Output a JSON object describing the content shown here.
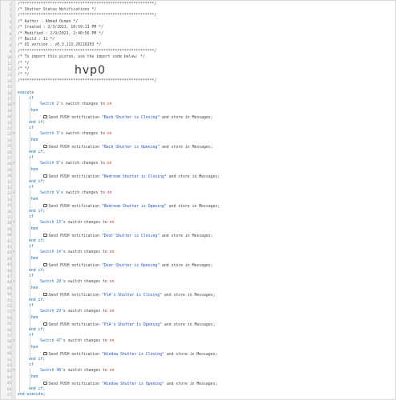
{
  "header": [
    "/**********************************************************/",
    "/* Shutter Status Notifications                            */",
    "/**********************************************************/",
    "/* Author       : Ahmed Osman                              */",
    "/* Created      : 2/3/2021, 10:59:13 PM                    */",
    "/* Modified     : 2/9/2021, 2:40:56 PM                     */",
    "/* Build        : 11                                       */",
    "/* UI version   : v0.3.113.20210203                        */",
    "/**********************************************************/",
    "/* To import this piston, use the import code below:      */",
    "/*                                                         */",
    "/*                                                         */",
    "/*                                                         */",
    "/**********************************************************/"
  ],
  "import_code": "hvp0",
  "kw": {
    "execute": "execute",
    "end_execute": "end execute;",
    "if": "if",
    "then": "then",
    "end_if": "end if;",
    "trigger": "⚡"
  },
  "blocks": [
    {
      "device": "Switch 2",
      "message": "\"Back Shutter is Closing\""
    },
    {
      "device": "Switch 3",
      "message": "\"Back Shutter is Opening\""
    },
    {
      "device": "Switch 8",
      "message": "\"Bedroom Shutter is Closing\""
    },
    {
      "device": "Switch 9",
      "message": "\"Bedroom Shutter is Opening\""
    },
    {
      "device": "Switch 13",
      "message": "\"Door Shutter is Closing\""
    },
    {
      "device": "Switch 14",
      "message": "\"Door Shutter is Opening\""
    },
    {
      "device": "Switch 28",
      "message": "\"PiA's Shutter is Closing\""
    },
    {
      "device": "Switch 29",
      "message": "\"PiA's Shutter is Opening\""
    },
    {
      "device": "Switch 47",
      "message": "\"Window Shutter is Closing\""
    },
    {
      "device": "Switch 48",
      "message": "\"Window Shutter is Opening\""
    }
  ],
  "phrases": {
    "possessive": "'s switch changes to",
    "value": "on",
    "send_prefix": "Send PUSH notification",
    "send_suffix": "and store in Messages;"
  },
  "line_numbers": [
    "1",
    "2",
    "3",
    "4",
    "5",
    "6",
    "7",
    "8",
    "9",
    "10",
    "11",
    "12",
    "13",
    "14",
    "15",
    "16",
    "17",
    "18",
    "19",
    "20",
    "21",
    "22",
    "23",
    "24",
    "25",
    "26",
    "27",
    "28",
    "29",
    "30",
    "31",
    "32",
    "33",
    "34",
    "35",
    "36",
    "37",
    "38",
    "39",
    "40",
    "41",
    "42",
    "43",
    "44",
    "45",
    "46",
    "47",
    "48",
    "49",
    "50",
    "51",
    "52",
    "53",
    "54",
    "55",
    "56",
    "57",
    "58",
    "59",
    "60",
    "61",
    "62",
    "63",
    "64",
    "65",
    "66",
    "67"
  ]
}
